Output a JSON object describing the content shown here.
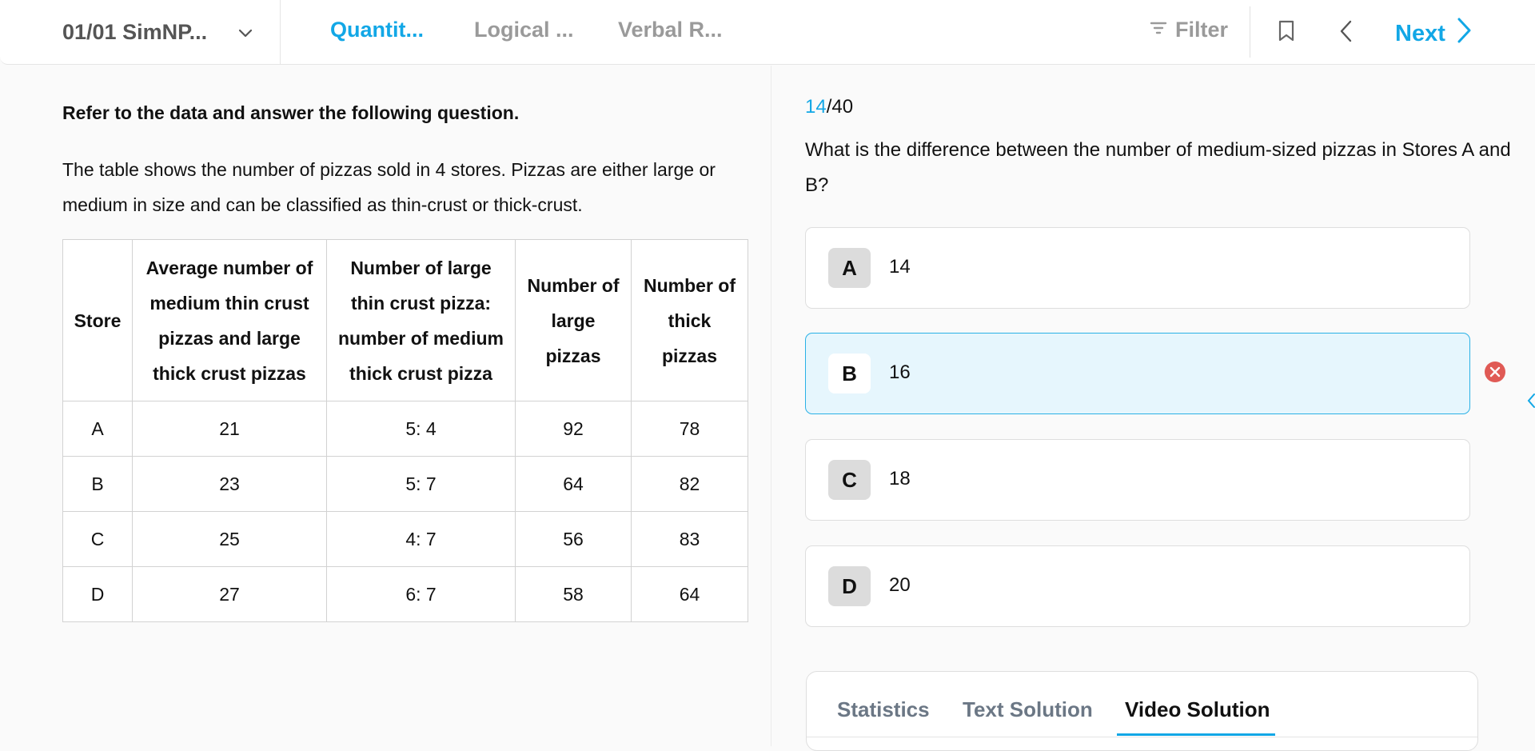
{
  "header": {
    "set_name": "01/01 SimNP...",
    "tabs": [
      "Quantit...",
      "Logical ...",
      "Verbal R..."
    ],
    "filter_label": "Filter",
    "next_label": "Next"
  },
  "passage": {
    "instruction": "Refer to the data and answer the following question.",
    "text": "The table shows the number of pizzas sold in 4 stores. Pizzas are either large or medium in size and can be classified as thin-crust or thick-crust."
  },
  "table": {
    "headers": [
      "Store",
      "Average number of medium thin crust pizzas and large thick crust pizzas",
      "Number of large thin crust pizza: number of medium thick crust pizza",
      "Number of large pizzas",
      "Number of thick pizzas"
    ],
    "rows": [
      [
        "A",
        "21",
        "5: 4",
        "92",
        "78"
      ],
      [
        "B",
        "23",
        "5: 7",
        "64",
        "82"
      ],
      [
        "C",
        "25",
        "4: 7",
        "56",
        "83"
      ],
      [
        "D",
        "27",
        "6: 7",
        "58",
        "64"
      ]
    ]
  },
  "question": {
    "current": "14",
    "total": "/40",
    "text": "What is the difference between the number of medium-sized pizzas in Stores A and B?"
  },
  "options": [
    {
      "letter": "A",
      "text": "14",
      "selected": false
    },
    {
      "letter": "B",
      "text": "16",
      "selected": true
    },
    {
      "letter": "C",
      "text": "18",
      "selected": false
    },
    {
      "letter": "D",
      "text": "20",
      "selected": false
    }
  ],
  "solution_tabs": [
    "Statistics",
    "Text Solution",
    "Video Solution"
  ],
  "colors": {
    "accent": "#12a7e6",
    "selected_bg": "#e6f6fd",
    "wrong": "#e05a55"
  },
  "icons": {
    "set_dropdown": "chevron-down-icon",
    "filter": "filter-icon",
    "bookmark": "bookmark-icon",
    "previous": "chevron-left-icon",
    "next": "chevron-right-icon",
    "wrong_answer": "close-circle-icon",
    "panel_toggle": "chevron-left-icon"
  }
}
